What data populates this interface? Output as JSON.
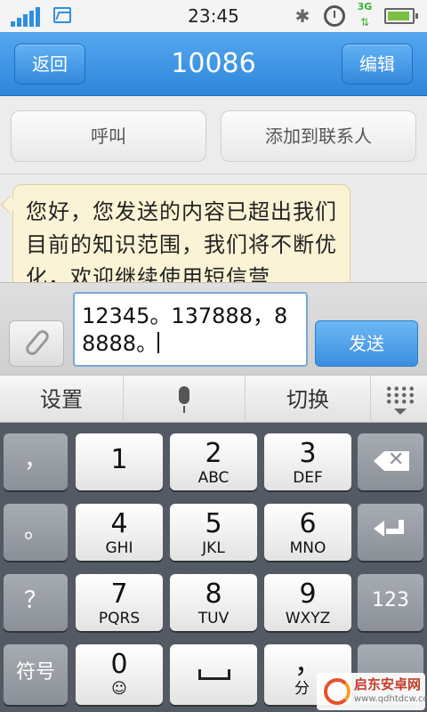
{
  "status_bar": {
    "time": "23:45",
    "network_label": "3G",
    "icons": [
      "signal-icon",
      "picture-icon",
      "bluetooth-icon",
      "alarm-icon",
      "3g-icon",
      "battery-icon"
    ]
  },
  "header": {
    "back_label": "返回",
    "title": "10086",
    "edit_label": "编辑"
  },
  "actions": {
    "call_label": "呼叫",
    "add_contact_label": "添加到联系人"
  },
  "conversation": {
    "messages": [
      {
        "direction": "incoming",
        "text": "您好，您发送的内容已超出我们目前的知识范围，我们将不断优化，欢迎继续使用短信营"
      }
    ]
  },
  "compose": {
    "input_value": "12345。137888，88888。",
    "send_label": "发送"
  },
  "keyboard": {
    "toolbar": {
      "settings_label": "设置",
      "switch_label": "切换"
    },
    "keys": {
      "comma_label": "，",
      "period_label": "。",
      "question_label": "？",
      "symbols_label": "符号",
      "numbers_label": "123",
      "k1_num": "1",
      "k2_num": "2",
      "k2_sub": "ABC",
      "k3_num": "3",
      "k3_sub": "DEF",
      "k4_num": "4",
      "k4_sub": "GHI",
      "k5_num": "5",
      "k5_sub": "JKL",
      "k6_num": "6",
      "k6_sub": "MNO",
      "k7_num": "7",
      "k7_sub": "PQRS",
      "k8_num": "8",
      "k8_sub": "TUV",
      "k9_num": "9",
      "k9_sub": "WXYZ",
      "k0_num": "0",
      "k0_sub": "☺",
      "comma2_label": "，",
      "comma2_sub": "分"
    }
  },
  "watermark": {
    "text": "启东安卓网",
    "url": "www.qdhtdcw.com"
  },
  "colors": {
    "header_blue": "#3a8fe0",
    "bubble": "#fbf3d5",
    "keyboard_bg": "#545a63"
  }
}
